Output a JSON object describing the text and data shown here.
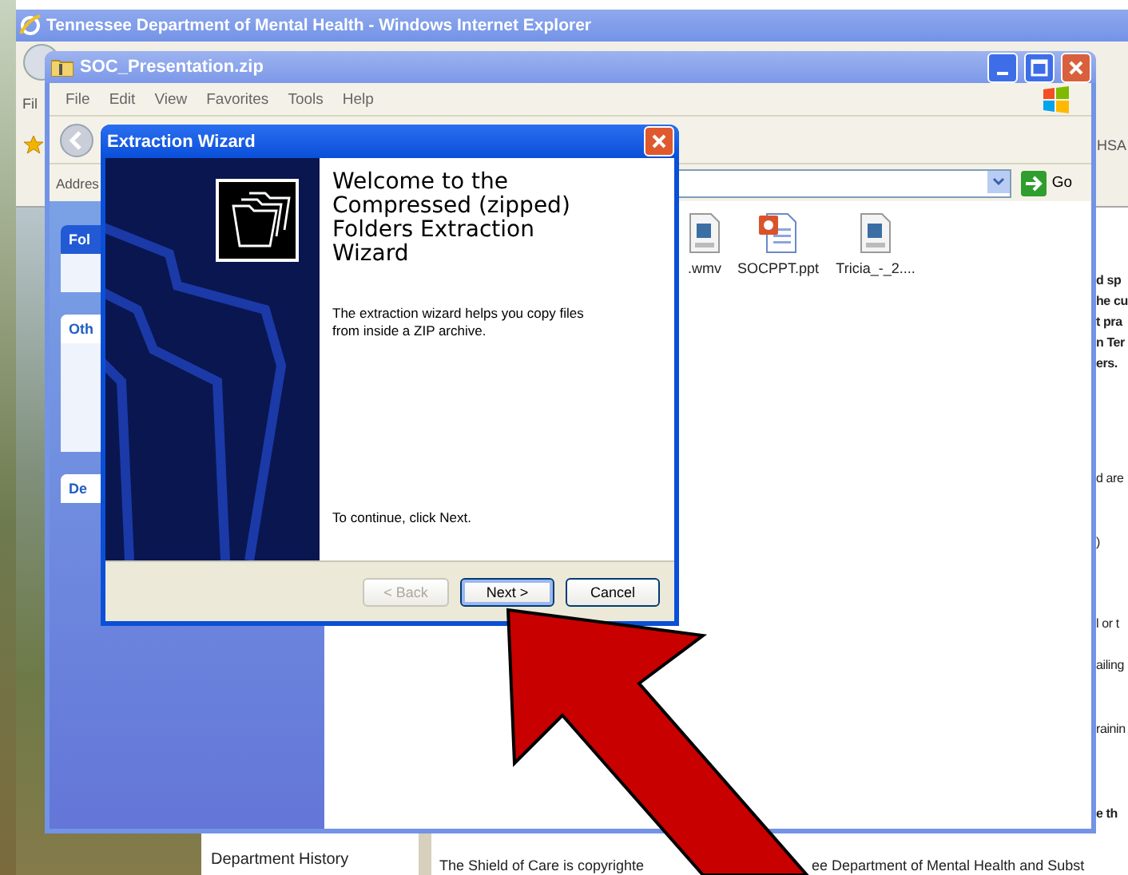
{
  "browser": {
    "title": "Tennessee Department of Mental Health - Windows Internet Explorer",
    "menu_fragment": "Fil",
    "links_fragment": "HSA"
  },
  "explorer": {
    "title": "SOC_Presentation.zip",
    "menu": [
      "File",
      "Edit",
      "View",
      "Favorites",
      "Tools",
      "Help"
    ],
    "address_label": "Addres",
    "go_label": "Go",
    "task_panels": [
      {
        "title": "Fol"
      },
      {
        "title": "Oth"
      },
      {
        "title": "De"
      }
    ],
    "files": [
      {
        "name": ".wmv",
        "kind": "video"
      },
      {
        "name": "SOCPPT.ppt",
        "kind": "presentation"
      },
      {
        "name": "Tricia_-_2....",
        "kind": "video"
      }
    ]
  },
  "wizard": {
    "title": "Extraction Wizard",
    "heading": "Welcome to the Compressed (zipped) Folders Extraction Wizard",
    "description": "The extraction wizard helps you copy files from inside a ZIP archive.",
    "instruction": "To continue, click Next.",
    "buttons": [
      {
        "label": "< Back",
        "disabled": true,
        "selected": false
      },
      {
        "label": "Next >",
        "disabled": false,
        "selected": true
      },
      {
        "label": "Cancel",
        "disabled": false,
        "selected": false
      }
    ]
  },
  "web_page": {
    "sidebar_link": "Department History",
    "fragments": [
      {
        "text": "d sp",
        "bold": true
      },
      {
        "text": "he cu",
        "bold": true
      },
      {
        "text": "t pra",
        "bold": true
      },
      {
        "text": "n Ter",
        "bold": true
      },
      {
        "text": "ers.",
        "bold": true
      },
      {
        "text": "d are",
        "bold": false
      },
      {
        "text": ")",
        "bold": false
      },
      {
        "text": "l or t",
        "bold": false
      },
      {
        "text": "ailing",
        "bold": false
      },
      {
        "text": "rainin",
        "bold": false
      },
      {
        "text": "e th",
        "bold": true
      }
    ],
    "footer": [
      "The Shield of Care is copyrighte",
      "ee Department of Mental Health and Subst"
    ]
  }
}
